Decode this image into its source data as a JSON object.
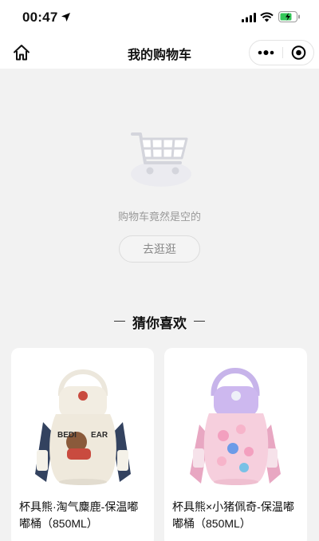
{
  "status_bar": {
    "time": "00:47",
    "icons": [
      "location-arrow-icon",
      "signal-icon",
      "wifi-icon",
      "battery-icon"
    ],
    "battery_charging": true
  },
  "nav": {
    "title": "我的购物车",
    "home_icon": "home-icon",
    "more_icon": "more-dots-icon",
    "close_icon": "target-close-icon"
  },
  "empty_cart": {
    "icon": "shopping-cart-icon",
    "message": "购物车竟然是空的",
    "browse_label": "去逛逛"
  },
  "recommend": {
    "title": "猜你喜欢",
    "products": [
      {
        "name": "杯具熊·淘气麋鹿-保温嘟嘟桶（850ML）",
        "image_icon": "white-bear-bottle-image",
        "accent": "#e9e3d4"
      },
      {
        "name": "杯具熊×小猪佩奇-保温嘟嘟桶（850ML）",
        "image_icon": "pink-peppa-bottle-image",
        "accent": "#f3c9da"
      }
    ]
  },
  "colors": {
    "background": "#f2f2f2",
    "card": "#ffffff",
    "muted_text": "#9a9a9a",
    "battery_green": "#34c759"
  }
}
